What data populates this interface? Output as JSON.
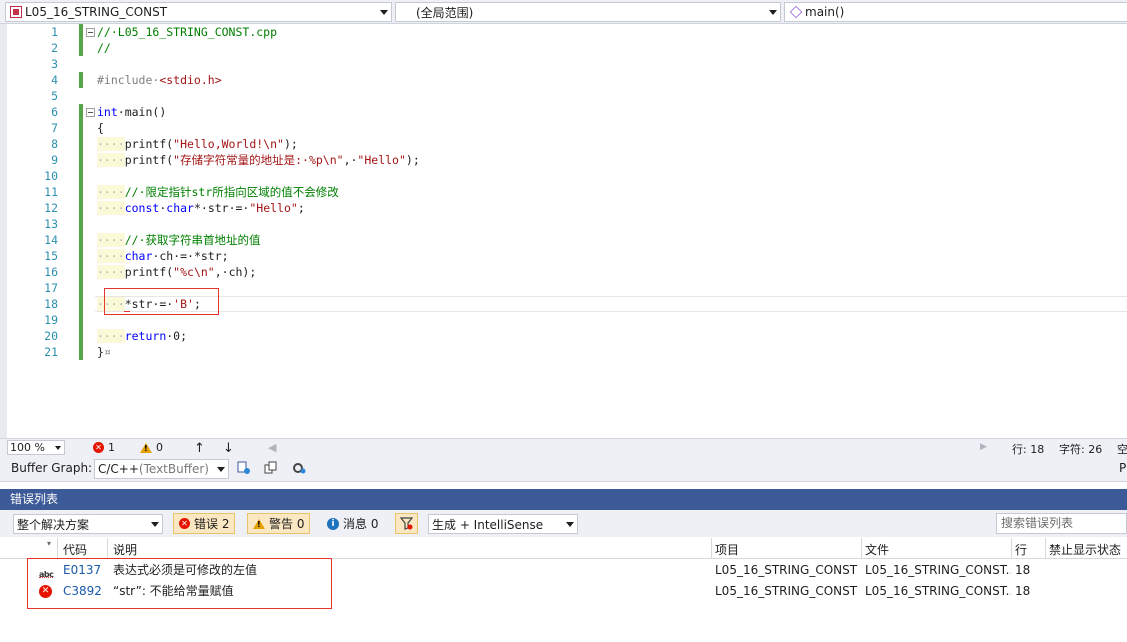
{
  "navbar": {
    "project_combo": "L05_16_STRING_CONST",
    "scope_combo": "(全局范围)",
    "member_combo": "main()"
  },
  "editor": {
    "lines": [
      {
        "n": "1",
        "tokens": [
          {
            "c": "comment",
            "t": "//·L05_16_STRING_CONST.cpp"
          }
        ]
      },
      {
        "n": "2",
        "tokens": [
          {
            "c": "comment",
            "t": "//"
          }
        ]
      },
      {
        "n": "3",
        "tokens": []
      },
      {
        "n": "4",
        "tokens": [
          {
            "c": "pre",
            "t": "#include·"
          },
          {
            "c": "str",
            "t": "<stdio.h>"
          }
        ]
      },
      {
        "n": "5",
        "tokens": []
      },
      {
        "n": "6",
        "tokens": [
          {
            "c": "kw",
            "t": "int"
          },
          {
            "c": "plain",
            "t": "·main()"
          }
        ]
      },
      {
        "n": "7",
        "tokens": [
          {
            "c": "plain",
            "t": "{"
          }
        ]
      },
      {
        "n": "8",
        "tokens": [
          {
            "c": "ws",
            "t": "····"
          },
          {
            "c": "plain",
            "t": "printf("
          },
          {
            "c": "str",
            "t": "\"Hello,World!\\n\""
          },
          {
            "c": "plain",
            "t": ");"
          }
        ]
      },
      {
        "n": "9",
        "tokens": [
          {
            "c": "ws",
            "t": "····"
          },
          {
            "c": "plain",
            "t": "printf("
          },
          {
            "c": "str",
            "t": "\"存储字符常量的地址是:·%p\\n\""
          },
          {
            "c": "plain",
            "t": ",·"
          },
          {
            "c": "str",
            "t": "\"Hello\""
          },
          {
            "c": "plain",
            "t": ");"
          }
        ]
      },
      {
        "n": "10",
        "tokens": []
      },
      {
        "n": "11",
        "tokens": [
          {
            "c": "ws",
            "t": "····"
          },
          {
            "c": "comment",
            "t": "//·限定指针str所指向区域的值不会修改"
          }
        ]
      },
      {
        "n": "12",
        "tokens": [
          {
            "c": "ws",
            "t": "····"
          },
          {
            "c": "kw",
            "t": "const"
          },
          {
            "c": "plain",
            "t": "·"
          },
          {
            "c": "kw",
            "t": "char"
          },
          {
            "c": "plain",
            "t": "*·str·=·"
          },
          {
            "c": "str",
            "t": "\"Hello\""
          },
          {
            "c": "plain",
            "t": ";"
          }
        ]
      },
      {
        "n": "13",
        "tokens": []
      },
      {
        "n": "14",
        "tokens": [
          {
            "c": "ws",
            "t": "····"
          },
          {
            "c": "comment",
            "t": "//·获取字符串首地址的值"
          }
        ]
      },
      {
        "n": "15",
        "tokens": [
          {
            "c": "ws",
            "t": "····"
          },
          {
            "c": "kw",
            "t": "char"
          },
          {
            "c": "plain",
            "t": "·ch·=·*str;"
          }
        ]
      },
      {
        "n": "16",
        "tokens": [
          {
            "c": "ws",
            "t": "····"
          },
          {
            "c": "plain",
            "t": "printf("
          },
          {
            "c": "str",
            "t": "\"%c\\n\""
          },
          {
            "c": "plain",
            "t": ",·ch);"
          }
        ]
      },
      {
        "n": "17",
        "tokens": []
      },
      {
        "n": "18",
        "tokens": [
          {
            "c": "ws",
            "t": "····"
          },
          {
            "c": "plain",
            "t": "*str·=·"
          },
          {
            "c": "str",
            "t": "'B'"
          },
          {
            "c": "plain",
            "t": ";"
          }
        ]
      },
      {
        "n": "19",
        "tokens": []
      },
      {
        "n": "20",
        "tokens": [
          {
            "c": "ws",
            "t": "····"
          },
          {
            "c": "kw",
            "t": "return"
          },
          {
            "c": "plain",
            "t": "·0;"
          }
        ]
      },
      {
        "n": "21",
        "tokens": [
          {
            "c": "plain",
            "t": "}"
          },
          {
            "c": "pre",
            "t": "¤"
          }
        ]
      }
    ]
  },
  "status": {
    "zoom": "100 %",
    "errors": "1",
    "warnings": "0",
    "row": "行: 18",
    "col": "字符: 26",
    "trailing": "空"
  },
  "buffer_graph": {
    "label": "Buffer Graph:",
    "content_type_prefix": "C/C++",
    "content_type_suffix": " (TextBuffer)",
    "right_text": "P"
  },
  "error_list": {
    "title": "错误列表",
    "scope": "整个解决方案",
    "errors_btn": "错误 2",
    "warnings_btn": "警告 0",
    "messages_btn": "消息 0",
    "build_filter": "生成 + IntelliSense",
    "search_placeholder": "搜索错误列表",
    "columns": {
      "code": "代码",
      "description": "说明",
      "project": "项目",
      "file": "文件",
      "line": "行",
      "suppression": "禁止显示状态"
    },
    "rows": [
      {
        "kind": "intellisense",
        "code": "E0137",
        "description": "表达式必须是可修改的左值",
        "project": "L05_16_STRING_CONST",
        "file": "L05_16_STRING_CONST...",
        "line": "18"
      },
      {
        "kind": "error",
        "code": "C3892",
        "description": "“str”: 不能给常量赋值",
        "project": "L05_16_STRING_CONST",
        "file": "L05_16_STRING_CONST...",
        "line": "18"
      }
    ]
  }
}
